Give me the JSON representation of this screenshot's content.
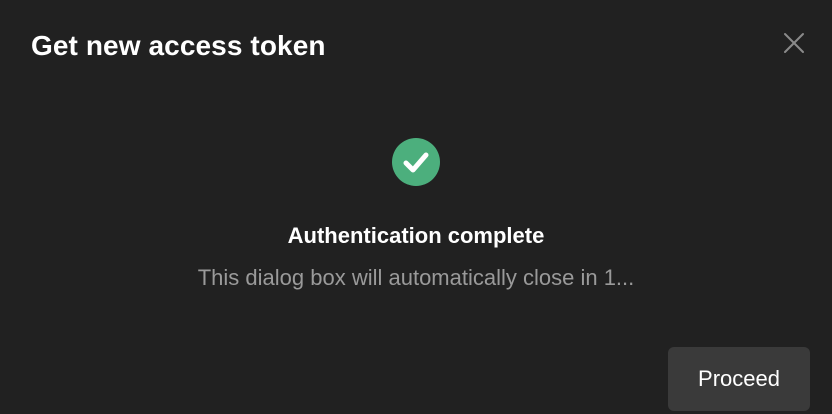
{
  "dialog": {
    "title": "Get new access token",
    "close_icon": "close-icon"
  },
  "status": {
    "icon": "check-circle-icon",
    "icon_color": "#4caf7d",
    "heading": "Authentication complete",
    "message": "This dialog box will automatically close in 1..."
  },
  "actions": {
    "proceed_label": "Proceed"
  },
  "colors": {
    "background": "#212121",
    "button_background": "#3a3a3a",
    "muted_text": "#9a9a9a"
  }
}
